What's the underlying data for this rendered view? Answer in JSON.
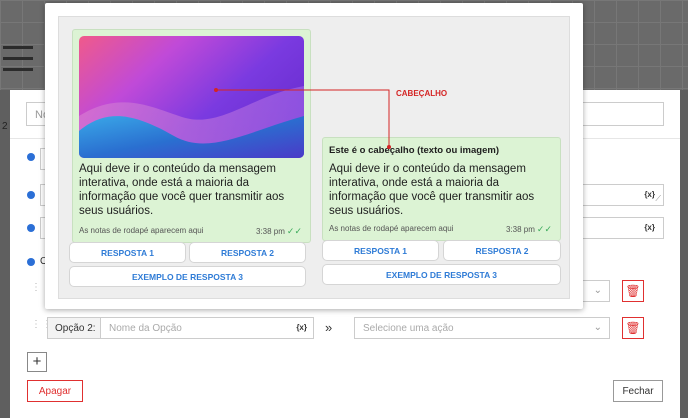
{
  "background": {
    "left_number": "2",
    "top_input_placeholder": "No"
  },
  "modal": {
    "option_group_letter": "O",
    "option2_label": "Opção 2:",
    "option2_name_placeholder": "Nome da Opção",
    "variable_tag": "{x}",
    "arrow": "»",
    "select_placeholder": "Selecione uma ação",
    "add_label": "+",
    "delete_label": "Apagar",
    "close_label": "Fechar"
  },
  "preview": {
    "callout_label": "CABEÇALHO",
    "bubble1": {
      "body": "Aqui deve ir o conteúdo da mensagem interativa, onde está a maioria da informação que você quer transmitir aos seus usuários.",
      "footer": "As notas de rodapé aparecem aqui",
      "time": "3:38 pm",
      "buttons": [
        "RESPOSTA 1",
        "RESPOSTA 2",
        "EXEMPLO DE RESPOSTA 3"
      ]
    },
    "bubble2": {
      "header": "Este é o cabeçalho (texto ou imagem)",
      "body": "Aqui deve ir o conteúdo da mensagem interativa, onde está a maioria da informação que você quer transmitir aos seus usuários.",
      "footer": "As notas de rodapé aparecem aqui",
      "time": "3:38 pm",
      "buttons": [
        "RESPOSTA 1",
        "RESPOSTA 2",
        "EXEMPLO DE RESPOSTA 3"
      ]
    }
  },
  "colors": {
    "accent_blue": "#2e7bd6",
    "danger_red": "#e03030",
    "bubble_green": "#dcf3d4",
    "callout_red": "#d42424"
  }
}
